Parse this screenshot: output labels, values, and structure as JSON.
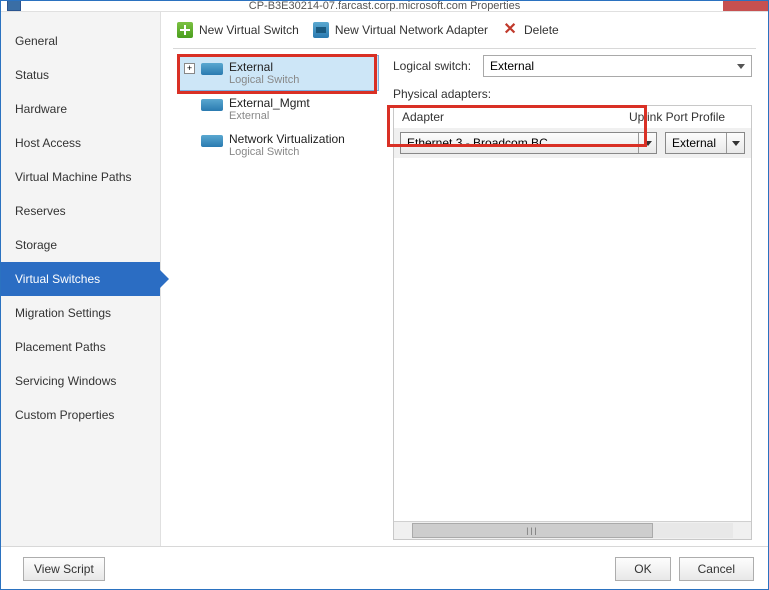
{
  "window": {
    "title": "CP-B3E30214-07.farcast.corp.microsoft.com Properties"
  },
  "sidebar": {
    "items": [
      {
        "label": "General"
      },
      {
        "label": "Status"
      },
      {
        "label": "Hardware"
      },
      {
        "label": "Host Access"
      },
      {
        "label": "Virtual Machine Paths"
      },
      {
        "label": "Reserves"
      },
      {
        "label": "Storage"
      },
      {
        "label": "Virtual Switches"
      },
      {
        "label": "Migration Settings"
      },
      {
        "label": "Placement Paths"
      },
      {
        "label": "Servicing Windows"
      },
      {
        "label": "Custom Properties"
      }
    ],
    "active_index": 7
  },
  "toolbar": {
    "new_switch": "New Virtual Switch",
    "new_adapter": "New Virtual Network Adapter",
    "delete": "Delete"
  },
  "tree": {
    "items": [
      {
        "title": "External",
        "sub": "Logical Switch",
        "expandable": true,
        "selected": true
      },
      {
        "title": "External_Mgmt",
        "sub": "External",
        "expandable": false,
        "selected": false
      },
      {
        "title": "Network Virtualization",
        "sub": "Logical Switch",
        "expandable": false,
        "selected": false
      }
    ]
  },
  "details": {
    "logical_switch_label": "Logical switch:",
    "logical_switch_value": "External",
    "physical_adapters_label": "Physical adapters:",
    "grid": {
      "header_adapter": "Adapter",
      "header_uplink": "Uplink Port Profile",
      "row": {
        "adapter": "Ethernet 3 - Broadcom BC",
        "uplink": "External"
      }
    }
  },
  "footer": {
    "view_script": "View Script",
    "ok": "OK",
    "cancel": "Cancel"
  }
}
